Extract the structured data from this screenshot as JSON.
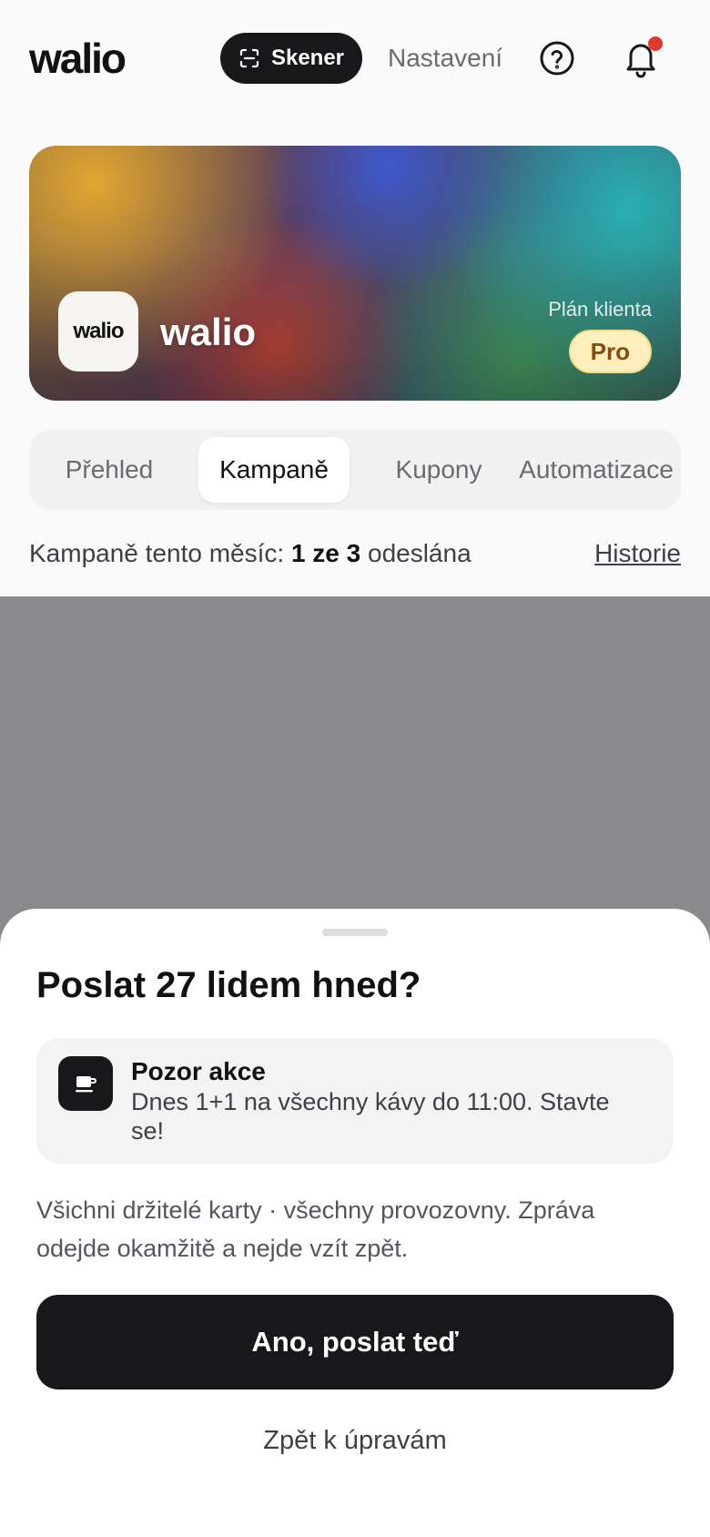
{
  "header": {
    "logo": "walio",
    "scanner_label": "Skener",
    "settings_label": "Nastavení",
    "help_icon": "help-circle-icon",
    "bell_icon": "bell-icon",
    "notification_dot_color": "#e03a2f"
  },
  "hero": {
    "badge_text": "walio",
    "business_name": "walio",
    "plan_label": "Plán klienta",
    "plan_value": "Pro"
  },
  "tabs": [
    {
      "label": "Přehled",
      "active": false
    },
    {
      "label": "Kampaně",
      "active": true
    },
    {
      "label": "Kupony",
      "active": false
    },
    {
      "label": "Automatizace",
      "active": false
    }
  ],
  "status": {
    "prefix": "Kampaně tento měsíc: ",
    "count": "1 ze 3",
    "suffix": " odeslána",
    "history_link": "Historie"
  },
  "sheet": {
    "title": "Poslat 27 lidem hned?",
    "message": {
      "icon": "coffee-cup-icon",
      "title": "Pozor akce",
      "body": "Dnes 1+1 na všechny kávy do 11:00. Stavte se!"
    },
    "description": "Všichni držitelé karty · všechny provozovny. Zpráva odejde okamžitě a nejde vzít zpět.",
    "confirm_label": "Ano, poslat teď",
    "back_label": "Zpět k úpravám"
  }
}
